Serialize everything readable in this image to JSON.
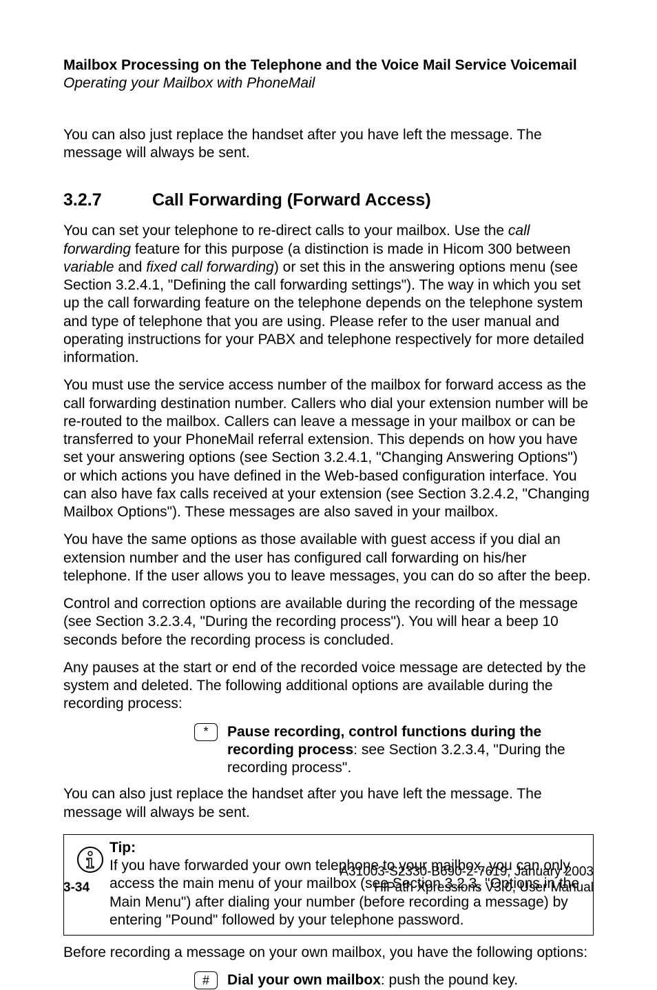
{
  "header": {
    "title": "Mailbox Processing on the Telephone and the Voice Mail Service Voicemail",
    "subtitle": "Operating your Mailbox with PhoneMail"
  },
  "intro_para": "You can also just replace the handset after you have left the message. The message will always be sent.",
  "section": {
    "number": "3.2.7",
    "title": "Call Forwarding (Forward Access)"
  },
  "p1_a": "You can set your telephone to re-direct calls to your mailbox. Use the ",
  "p1_cf": "call forwarding",
  "p1_b": " feature for this purpose (a distinction is made in Hicom 300 between ",
  "p1_var": "variable",
  "p1_c": " and ",
  "p1_fixed": "fixed call forwarding",
  "p1_d": ") or set this in the answering options menu (see Section 3.2.4.1, \"Defining the call forwarding settings\"). The way in which you set up the call forwarding feature on the telephone depends on the telephone system and type of telephone that you are using. Please refer to the user manual and operating instructions for your PABX and telephone respectively for more detailed information.",
  "p2": "You must use the service access number of the mailbox for forward access as the call forwarding destination number. Callers who dial your extension number will be re-routed to the mailbox. Callers can leave a message in your mailbox or can be transferred to your PhoneMail referral extension. This depends on how you have set your answering options (see Section 3.2.4.1, \"Changing Answering Options\") or which actions you have defined in the Web-based configuration interface. You can also have fax calls received at your extension (see Section 3.2.4.2, \"Changing Mailbox Options\"). These messages are also saved in your mailbox.",
  "p3": "You have the same options as those available with guest access if you dial an extension number and the user has configured call forwarding on his/her telephone. If the user allows you to leave messages, you can do so after the beep.",
  "p4": "Control and correction options are available during the recording of the message (see Section 3.2.3.4, \"During the recording process\"). You will hear a beep 10 seconds before the recording process is concluded.",
  "p5": "Any pauses at the start or end of the recorded voice message are detected by the system and deleted. The following additional options are available during the recording process:",
  "star_key": "*",
  "pause_bold": "Pause recording, control functions during the recording process",
  "pause_rest": ": see Section 3.2.3.4, \"During the recording process\".",
  "p6": "You can also just replace the handset after you have left the message. The message will always be sent.",
  "tip": {
    "label": "Tip:",
    "text": "If you have forwarded your own telephone to your mailbox, you can only access the main menu of your mailbox (see Section 3.2.3, \"Options in the Main Menu\") after dialing your number (before recording a message) by entering \"Pound\" followed by your telephone password."
  },
  "before_rec": "Before recording a message on your own mailbox, you have the following options:",
  "pound_key": "#",
  "dial_bold": "Dial your own mailbox",
  "dial_rest": ": push the pound key.",
  "footer": {
    "pageno": "3-34",
    "doc_id": "A31003-S2330-B690-2-7619, January 2003",
    "product": "HiPath Xpressions V3.0, User Manual"
  }
}
